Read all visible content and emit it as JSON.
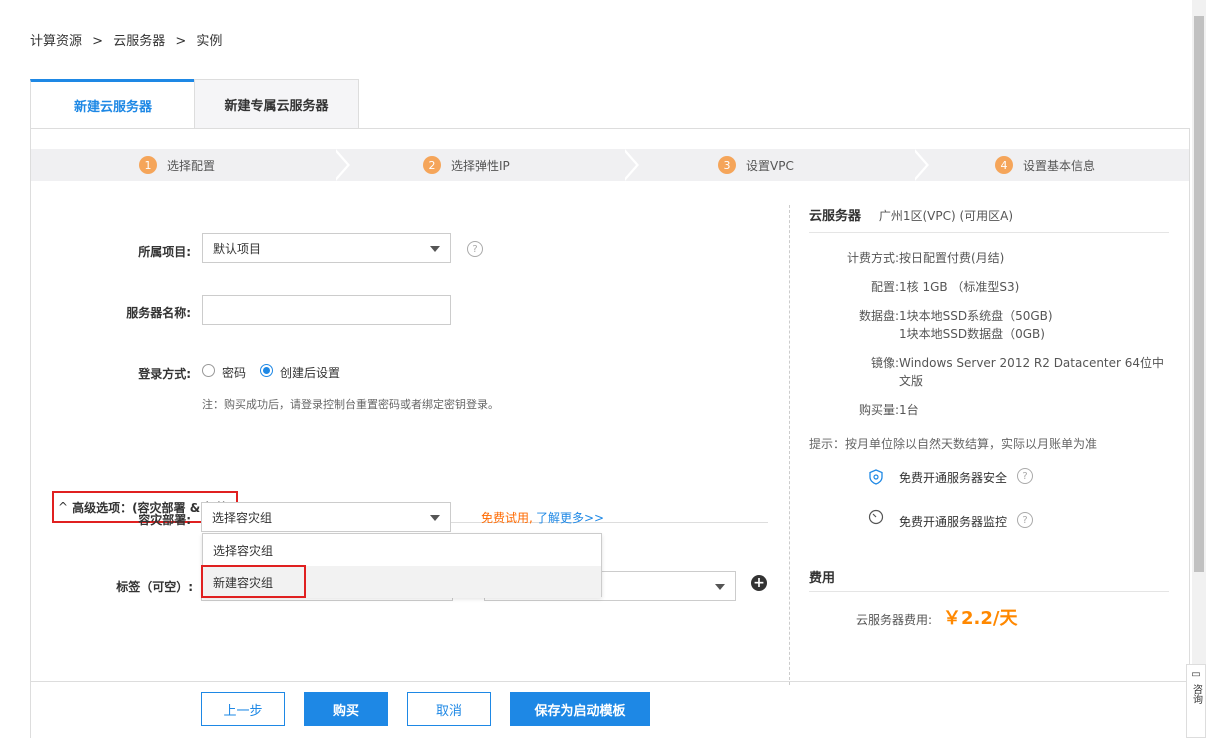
{
  "breadcrumb": [
    "计算资源",
    ">",
    "云服务器",
    ">",
    "实例"
  ],
  "tabs": [
    {
      "label": "新建云服务器",
      "active": true
    },
    {
      "label": "新建专属云服务器",
      "active": false
    }
  ],
  "steps": [
    {
      "num": "1",
      "label": "选择配置"
    },
    {
      "num": "2",
      "label": "选择弹性IP"
    },
    {
      "num": "3",
      "label": "设置VPC"
    },
    {
      "num": "4",
      "label": "设置基本信息"
    }
  ],
  "form": {
    "project_label": "所属项目:",
    "project_value": "默认项目",
    "name_label": "服务器名称:",
    "name_value": "",
    "login_label": "登录方式:",
    "login_options": [
      "密码",
      "创建后设置"
    ],
    "login_selected": "创建后设置",
    "login_note": "注：购买成功后，请登录控制台重置密码或者绑定密钥登录。",
    "advanced_label": "高级选项：(容灾部署 & 标签)",
    "disaster_label": "容灾部署:",
    "disaster_value": "选择容灾组",
    "free_trial": "免费试用,",
    "learn_more": "了解更多>>",
    "dropdown_options": [
      "选择容灾组",
      "新建容灾组"
    ],
    "tag_label": "标签（可空）:"
  },
  "summary": {
    "title": "云服务器",
    "region": "广州1区(VPC) (可用区A)",
    "billing_k": "计费方式:",
    "billing_v": "按日配置付费(月结)",
    "config_k": "配置:",
    "config_v": "1核 1GB （标准型S3)",
    "disk_k": "数据盘:",
    "disk_v1": "1块本地SSD系统盘（50GB)",
    "disk_v2": "1块本地SSD数据盘（0GB)",
    "image_k": "镜像:",
    "image_v": "Windows Server 2012 R2 Datacenter 64位中文版",
    "qty_k": "购买量:",
    "qty_v": "1台",
    "tip": "提示：按月单位除以自然天数结算，实际以月账单为准",
    "security": "免费开通服务器安全",
    "monitor": "免费开通服务器监控"
  },
  "fee": {
    "title": "费用",
    "label": "云服务器费用:",
    "value": "￥2.2/天"
  },
  "buttons": {
    "prev": "上一步",
    "buy": "购买",
    "cancel": "取消",
    "save_template": "保存为启动模板"
  },
  "side": {
    "consult": "咨询"
  },
  "colors": {
    "primary": "#1e88e5",
    "step_badge": "#f5a55a",
    "price": "#ff8800",
    "highlight": "#e02020"
  }
}
